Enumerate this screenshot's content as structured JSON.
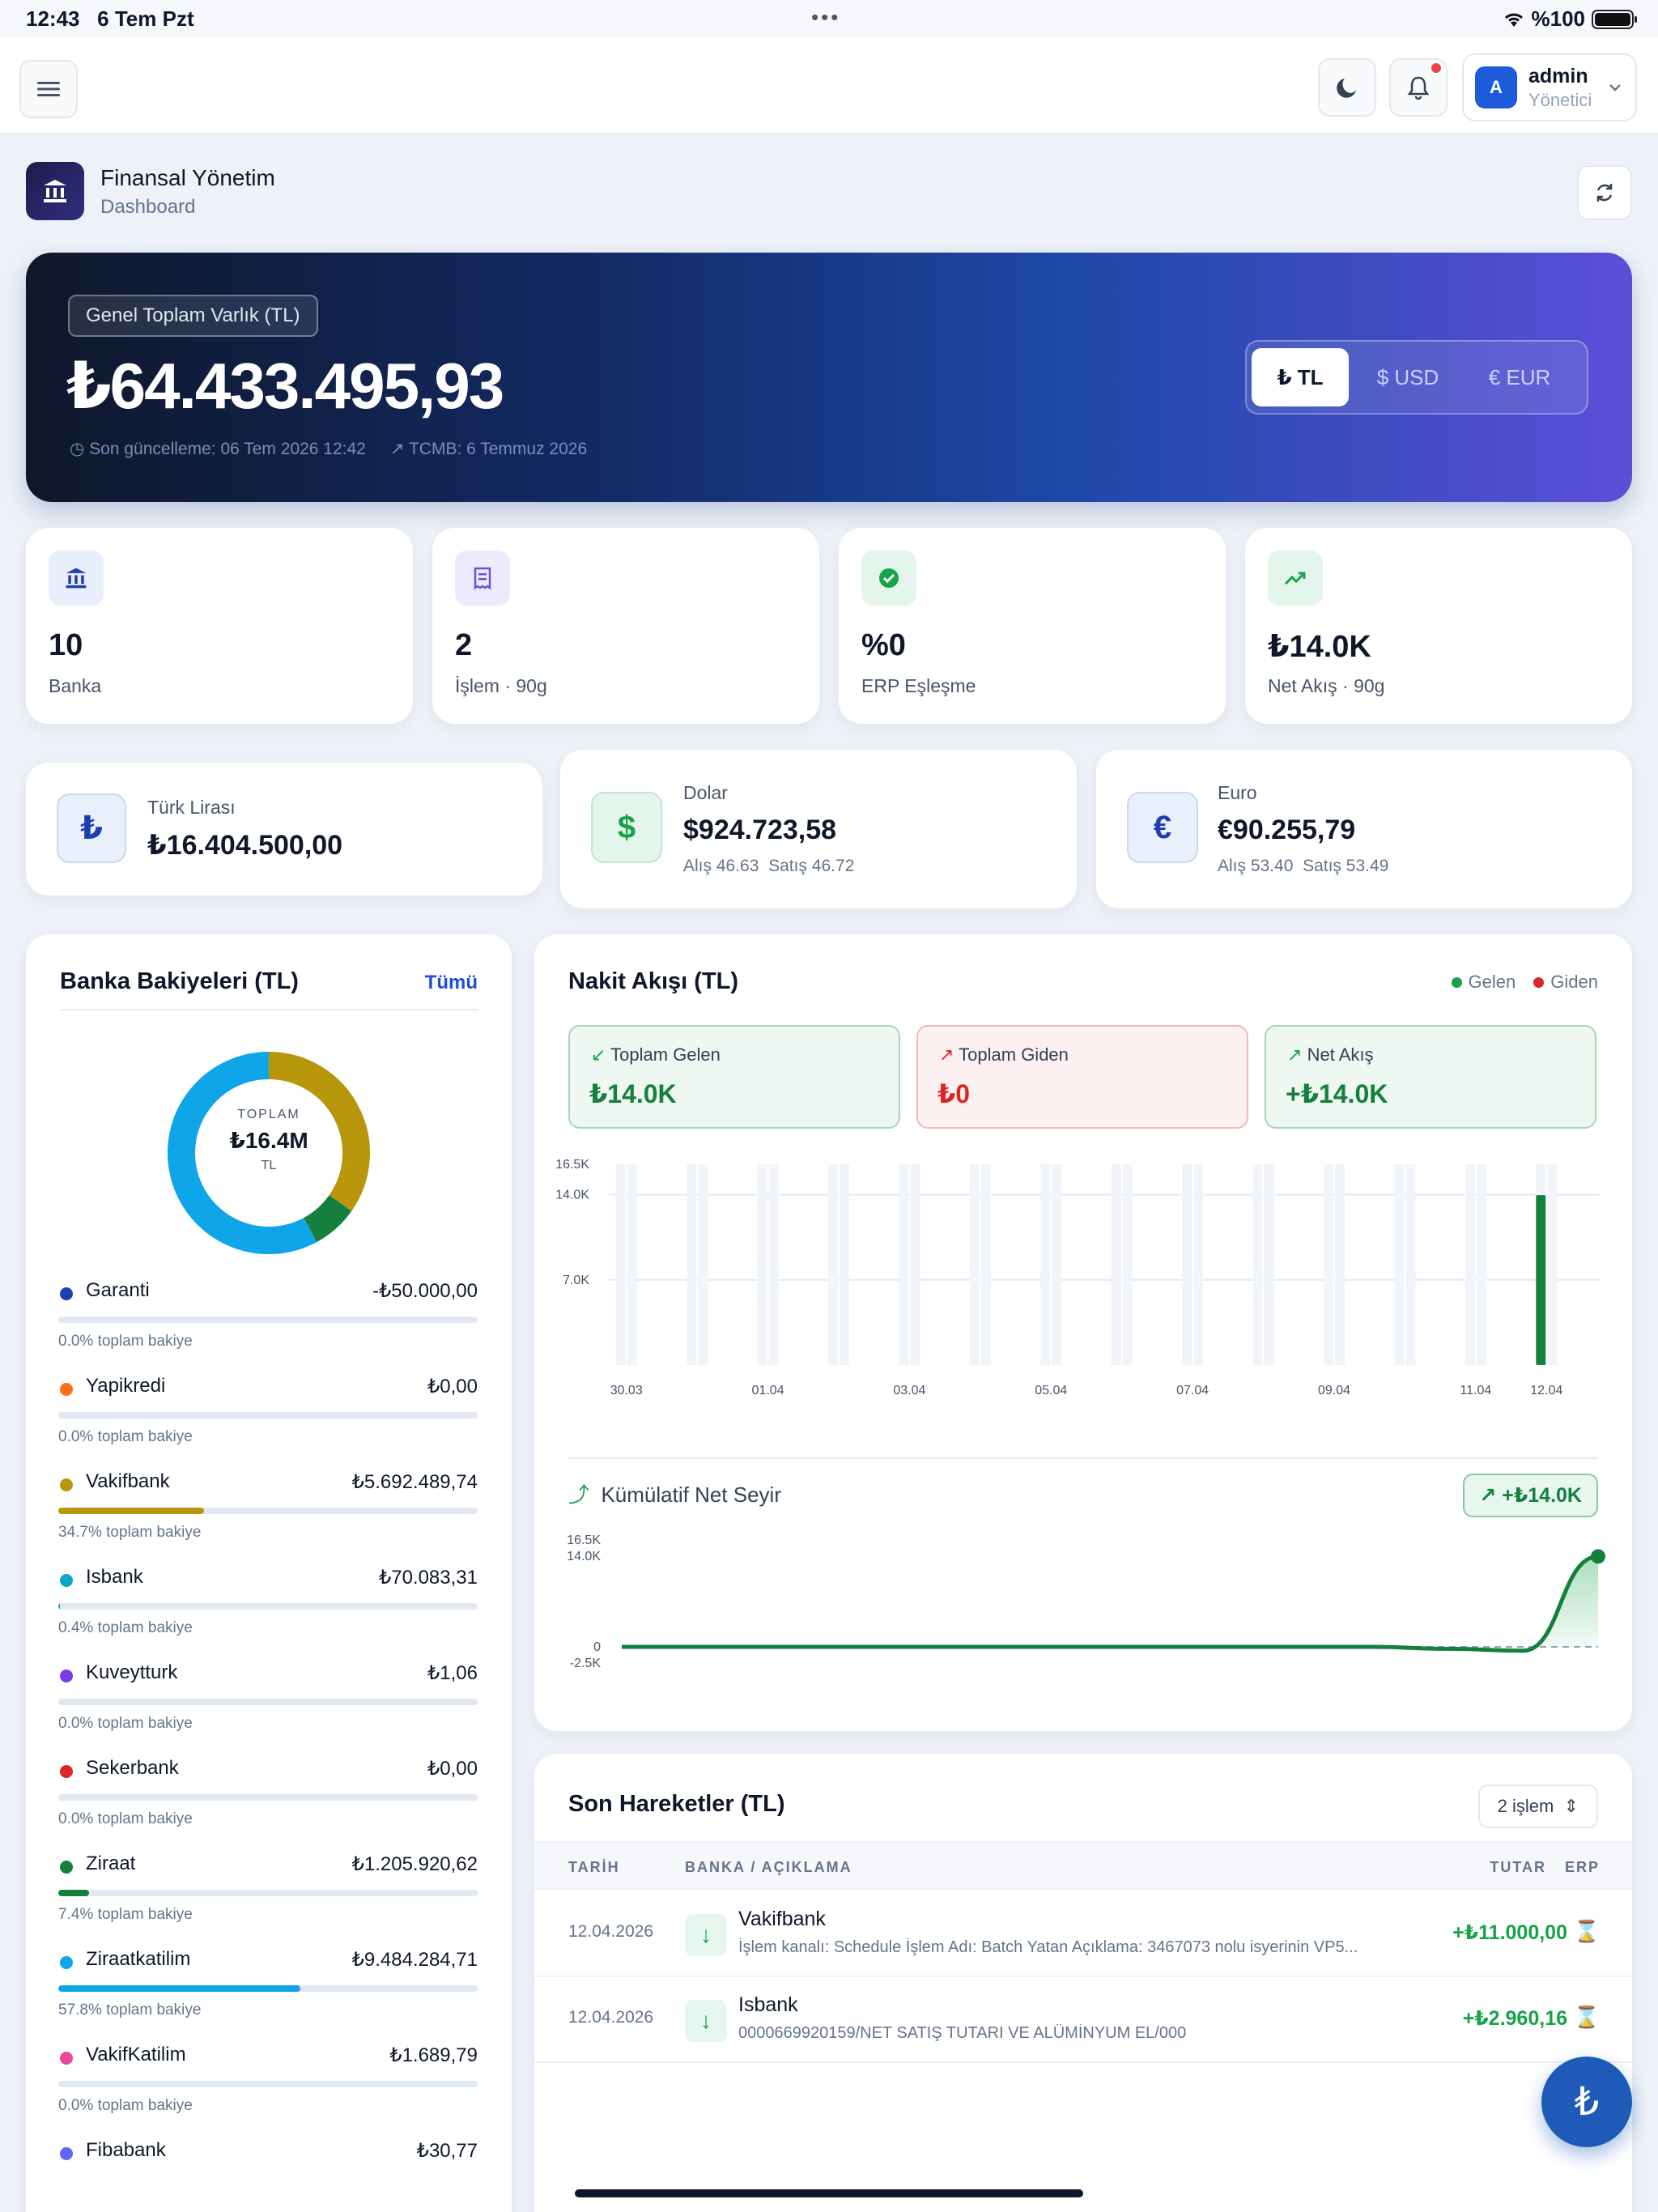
{
  "status_bar": {
    "time": "12:43",
    "date": "6 Tem Pzt",
    "battery": "%100"
  },
  "topnav": {
    "user_name": "admin",
    "user_role": "Yönetici",
    "avatar_letter": "A"
  },
  "header": {
    "title": "Finansal Yönetim",
    "subtitle": "Dashboard"
  },
  "hero": {
    "chip": "Genel Toplam Varlık (TL)",
    "amount": "₺64.433.495,93",
    "updated": "Son güncelleme: 06 Tem 2026 12:42",
    "tcmb": "TCMB: 6 Temmuz 2026",
    "currencies": [
      "₺ TL",
      "$ USD",
      "€ EUR"
    ],
    "active_currency": "₺ TL"
  },
  "stats": [
    {
      "value": "10",
      "label": "Banka",
      "icon": "bank-icon"
    },
    {
      "value": "2",
      "label": "İşlem · 90g",
      "icon": "receipt-icon"
    },
    {
      "value": "%0",
      "label": "ERP Eşleşme",
      "icon": "verified-icon"
    },
    {
      "value": "₺14.0K",
      "label": "Net Akış · 90g",
      "icon": "trend-up-icon"
    }
  ],
  "currency_cards": {
    "try": {
      "symbol": "₺",
      "name": "Türk Lirası",
      "value": "₺16.404.500,00"
    },
    "usd": {
      "symbol": "$",
      "name": "Dolar",
      "value": "$924.723,58",
      "buy": "Alış 46.63",
      "sell": "Satış 46.72"
    },
    "eur": {
      "symbol": "€",
      "name": "Euro",
      "value": "€90.255,79",
      "buy": "Alış 53.40",
      "sell": "Satış 53.49"
    }
  },
  "banks_panel": {
    "title": "Banka Bakiyeleri (TL)",
    "link": "Tümü",
    "donut_caption": "TOPLAM",
    "donut_total": "₺16.4M",
    "donut_unit": "TL",
    "banks": [
      {
        "name": "Garanti",
        "amount": "-₺50.000,00",
        "pct_label": "0.0% toplam bakiye",
        "fraction": 0.0,
        "color": "#1e40af"
      },
      {
        "name": "Yapikredi",
        "amount": "₺0,00",
        "pct_label": "0.0% toplam bakiye",
        "fraction": 0.0,
        "color": "#f97316"
      },
      {
        "name": "Vakifbank",
        "amount": "₺5.692.489,74",
        "pct_label": "34.7% toplam bakiye",
        "fraction": 0.347,
        "color": "#b8960c"
      },
      {
        "name": "Isbank",
        "amount": "₺70.083,31",
        "pct_label": "0.4% toplam bakiye",
        "fraction": 0.004,
        "color": "#0ea5c6"
      },
      {
        "name": "Kuveytturk",
        "amount": "₺1,06",
        "pct_label": "0.0% toplam bakiye",
        "fraction": 0.0,
        "color": "#7c3aed"
      },
      {
        "name": "Sekerbank",
        "amount": "₺0,00",
        "pct_label": "0.0% toplam bakiye",
        "fraction": 0.0,
        "color": "#dc2626"
      },
      {
        "name": "Ziraat",
        "amount": "₺1.205.920,62",
        "pct_label": "7.4% toplam bakiye",
        "fraction": 0.074,
        "color": "#15803d"
      },
      {
        "name": "Ziraatkatilim",
        "amount": "₺9.484.284,71",
        "pct_label": "57.8% toplam bakiye",
        "fraction": 0.578,
        "color": "#0ea5e9"
      },
      {
        "name": "VakifKatilim",
        "amount": "₺1.689,79",
        "pct_label": "0.0% toplam bakiye",
        "fraction": 0.0,
        "color": "#ec4899"
      },
      {
        "name": "Fibabank",
        "amount": "₺30,77",
        "pct_label": "",
        "fraction": 0.0,
        "color": "#6366f1"
      }
    ]
  },
  "flow_panel": {
    "title": "Nakit Akışı (TL)",
    "legend_in": "Gelen",
    "legend_out": "Giden",
    "total_in_label": "Toplam Gelen",
    "total_in": "₺14.0K",
    "total_out_label": "Toplam Giden",
    "total_out": "₺0",
    "net_label": "Net Akış",
    "net": "+₺14.0K",
    "cumulative_title": "Kümülatif Net Seyir",
    "cumulative_badge": "+₺14.0K"
  },
  "chart_data": [
    {
      "type": "bar",
      "title": "Nakit Akışı (TL)",
      "y_ticks": [
        "16.5K",
        "14.0K",
        "7.0K"
      ],
      "ylim": [
        0,
        16500
      ],
      "categories": [
        "30.03",
        "31.03",
        "01.04",
        "02.04",
        "03.04",
        "04.04",
        "05.04",
        "06.04",
        "07.04",
        "08.04",
        "09.04",
        "10.04",
        "11.04",
        "12.04"
      ],
      "x_tick_labels": [
        "30.03",
        "01.04",
        "03.04",
        "05.04",
        "07.04",
        "09.04",
        "11.04",
        "12.04"
      ],
      "series": [
        {
          "name": "Gelen",
          "values": [
            0,
            0,
            0,
            0,
            0,
            0,
            0,
            0,
            0,
            0,
            0,
            0,
            0,
            13960
          ]
        },
        {
          "name": "Giden",
          "values": [
            0,
            0,
            0,
            0,
            0,
            0,
            0,
            0,
            0,
            0,
            0,
            0,
            0,
            0
          ]
        }
      ]
    },
    {
      "type": "area",
      "title": "Kümülatif Net Seyir",
      "y_ticks": [
        "16.5K",
        "14.0K",
        "0",
        "-2.5K"
      ],
      "ylim": [
        -2500,
        16500
      ],
      "x": [
        0,
        1,
        2,
        3,
        4,
        5,
        6,
        7,
        8,
        9,
        10,
        11,
        12,
        13
      ],
      "values": [
        0,
        0,
        0,
        0,
        0,
        0,
        0,
        0,
        0,
        0,
        0,
        -300,
        -600,
        13960
      ]
    }
  ],
  "transactions": {
    "title": "Son Hareketler (TL)",
    "count": "2 işlem",
    "headers": {
      "date": "TARİH",
      "bank": "BANKA / AÇIKLAMA",
      "amount": "TUTAR",
      "erp": "ERP"
    },
    "rows": [
      {
        "date": "12.04.2026",
        "bank": "Vakifbank",
        "desc": "İşlem kanalı: Schedule İşlem Adı: Batch Yatan Açıklama: 3467073 nolu isyerinin VP5...",
        "amount": "+₺11.000,00"
      },
      {
        "date": "12.04.2026",
        "bank": "Isbank",
        "desc": "0000669920159/NET SATIŞ TUTARI   VE ALÜMİNYUM  EL/000",
        "amount": "+₺2.960,16"
      }
    ]
  },
  "fab": {
    "symbol": "₺"
  }
}
